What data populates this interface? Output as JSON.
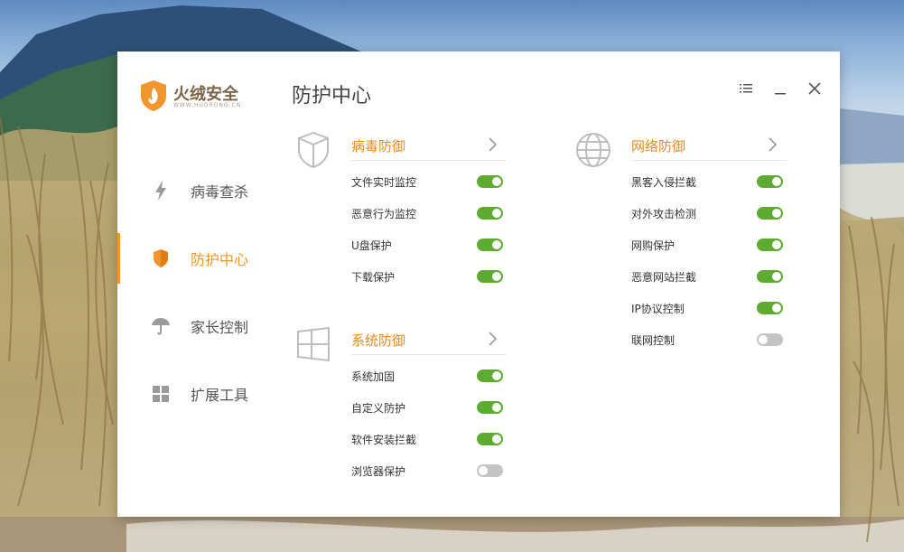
{
  "app": {
    "name": "火绒安全",
    "url": "WWW.HUORONG.CN",
    "colors": {
      "accent": "#f1962c",
      "section_title": "#e68a1f",
      "toggle_on": "#5dab31",
      "toggle_off": "#c4c4c4"
    }
  },
  "window_controls": [
    {
      "name": "menu",
      "icon": "menu-icon"
    },
    {
      "name": "minimize",
      "icon": "minimize-icon"
    },
    {
      "name": "close",
      "icon": "close-icon"
    }
  ],
  "sidebar": {
    "items": [
      {
        "label": "病毒查杀",
        "icon": "lightning-icon",
        "active": false
      },
      {
        "label": "防护中心",
        "icon": "shield-icon",
        "active": true
      },
      {
        "label": "家长控制",
        "icon": "umbrella-icon",
        "active": false
      },
      {
        "label": "扩展工具",
        "icon": "grid-icon",
        "active": false
      }
    ]
  },
  "page_title": "防护中心",
  "sections": [
    {
      "title": "病毒防御",
      "icon": "virus-shield-icon",
      "items": [
        {
          "label": "文件实时监控",
          "enabled": true
        },
        {
          "label": "恶意行为监控",
          "enabled": true
        },
        {
          "label": "U盘保护",
          "enabled": true
        },
        {
          "label": "下载保护",
          "enabled": true
        }
      ]
    },
    {
      "title": "系统防御",
      "icon": "windows-icon",
      "items": [
        {
          "label": "系统加固",
          "enabled": true
        },
        {
          "label": "自定义防护",
          "enabled": true
        },
        {
          "label": "软件安装拦截",
          "enabled": true
        },
        {
          "label": "浏览器保护",
          "enabled": false
        }
      ]
    },
    {
      "title": "网络防御",
      "icon": "globe-icon",
      "items": [
        {
          "label": "黑客入侵拦截",
          "enabled": true
        },
        {
          "label": "对外攻击检测",
          "enabled": true
        },
        {
          "label": "网购保护",
          "enabled": true
        },
        {
          "label": "恶意网站拦截",
          "enabled": true
        },
        {
          "label": "IP协议控制",
          "enabled": true
        },
        {
          "label": "联网控制",
          "enabled": false
        }
      ]
    }
  ]
}
